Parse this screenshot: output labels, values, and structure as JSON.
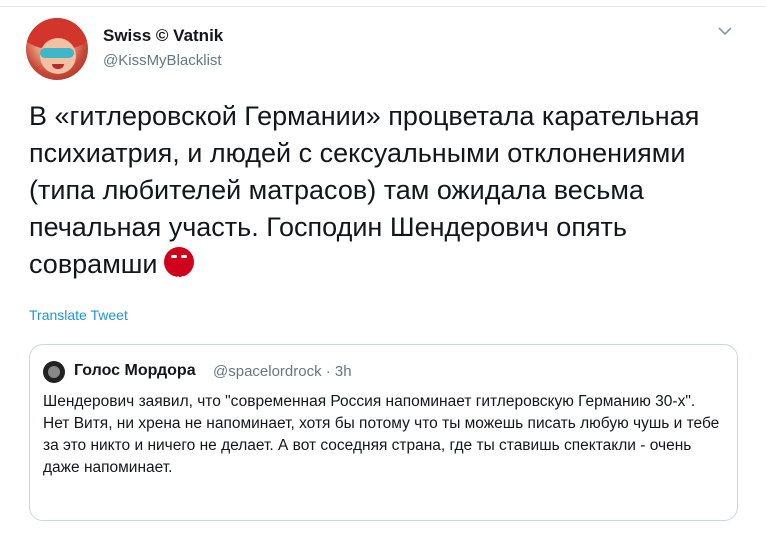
{
  "author": {
    "name": "Swiss © Vatnik",
    "handle": "@KissMyBlacklist"
  },
  "tweet": {
    "text": "В «гитлеровской Германии» процветала карательная психиатрия, и людей с сексуальными отклонениями (типа любителей матрасов) там ожидала весьма печальная участь. Господин Шендерович опять соврамши",
    "emoji_label": "#%!&",
    "emoji_icon": "face-with-symbols-on-mouth-icon",
    "translate_label": "Translate Tweet"
  },
  "quoted_tweet": {
    "name": "Голос Мордора",
    "handle_time": "@spacelordrock · 3h",
    "text": "Шендерович заявил, что \"современная Россия напоминает гитлеровскую Германию 30-х\".\nНет Витя, ни хрена не напоминает, хотя бы потому что ты можешь писать любую чушь и тебе за это никто и ничего не делает. А вот соседняя страна, где ты ставишь спектакли - очень даже напоминает."
  },
  "colors": {
    "link": "#1b95e0",
    "secondary_text": "#657786",
    "border": "#ccd6dd",
    "emoji_red": "#d0021b"
  }
}
